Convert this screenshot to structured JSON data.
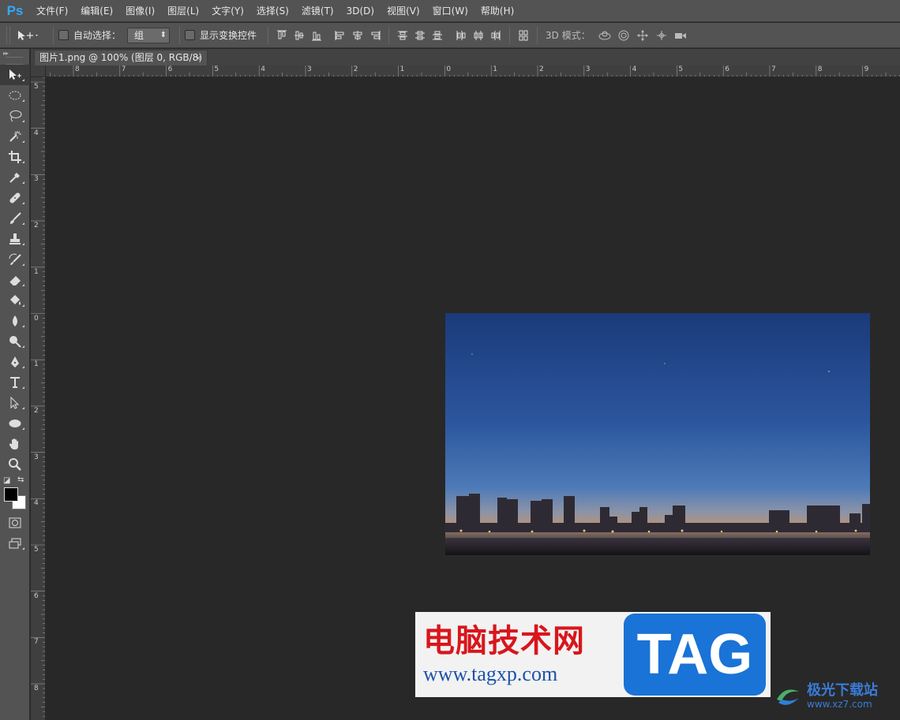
{
  "app": {
    "logo": "Ps"
  },
  "menu": [
    "文件(F)",
    "编辑(E)",
    "图像(I)",
    "图层(L)",
    "文字(Y)",
    "选择(S)",
    "滤镜(T)",
    "3D(D)",
    "视图(V)",
    "窗口(W)",
    "帮助(H)"
  ],
  "options": {
    "auto_select_label": "自动选择：",
    "auto_select_value": "组",
    "show_transform_label": "显示变换控件",
    "mode3d_label": "3D 模式："
  },
  "document": {
    "tab_title": "图片1.png @ 100% (图层 0, RGB/8)",
    "close_glyph": "×"
  },
  "ruler": {
    "h_labels": [
      "8",
      "7",
      "6",
      "5",
      "4",
      "3",
      "2",
      "1",
      "0",
      "1",
      "2",
      "3",
      "4",
      "5",
      "6",
      "7",
      "8",
      "9"
    ],
    "v_labels": [
      "5",
      "4",
      "3",
      "2",
      "1",
      "0",
      "1",
      "2",
      "3",
      "4",
      "5",
      "6",
      "7",
      "8"
    ]
  },
  "colors": {
    "foreground": "#000000",
    "background": "#ffffff",
    "ps_blue": "#31a8ff"
  },
  "watermark": {
    "title": "电脑技术网",
    "url": "www.tagxp.com",
    "tag": "TAG"
  },
  "site_logo": {
    "name": "极光下载站",
    "url": "www.xz7.com"
  }
}
